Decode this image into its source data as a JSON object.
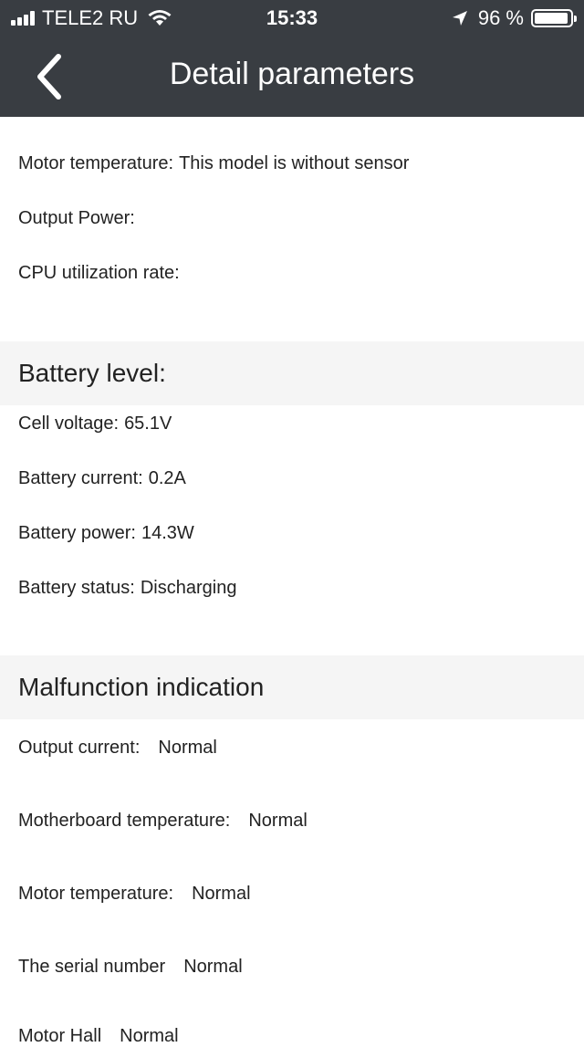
{
  "status_bar": {
    "carrier": "TELE2 RU",
    "time": "15:33",
    "battery_percent": "96 %"
  },
  "nav": {
    "title": "Detail parameters"
  },
  "params": [
    {
      "label": "Motor temperature:",
      "value": "This model is without sensor"
    },
    {
      "label": "Output Power:",
      "value": ""
    },
    {
      "label": "CPU utilization rate:",
      "value": ""
    }
  ],
  "battery_section": {
    "title": "Battery level:",
    "items": [
      {
        "label": "Cell voltage:",
        "value": "65.1V"
      },
      {
        "label": "Battery current:",
        "value": "0.2A"
      },
      {
        "label": "Battery power:",
        "value": "14.3W"
      },
      {
        "label": "Battery status:",
        "value": "Discharging"
      }
    ]
  },
  "malfunction_section": {
    "title": "Malfunction indication",
    "items": [
      {
        "label": "Output current:",
        "value": "Normal"
      },
      {
        "label": "Motherboard temperature:",
        "value": "Normal"
      },
      {
        "label": "Motor temperature:",
        "value": "Normal"
      },
      {
        "label": "The serial number",
        "value": "Normal"
      },
      {
        "label": "Motor Hall",
        "value": "Normal"
      }
    ]
  }
}
